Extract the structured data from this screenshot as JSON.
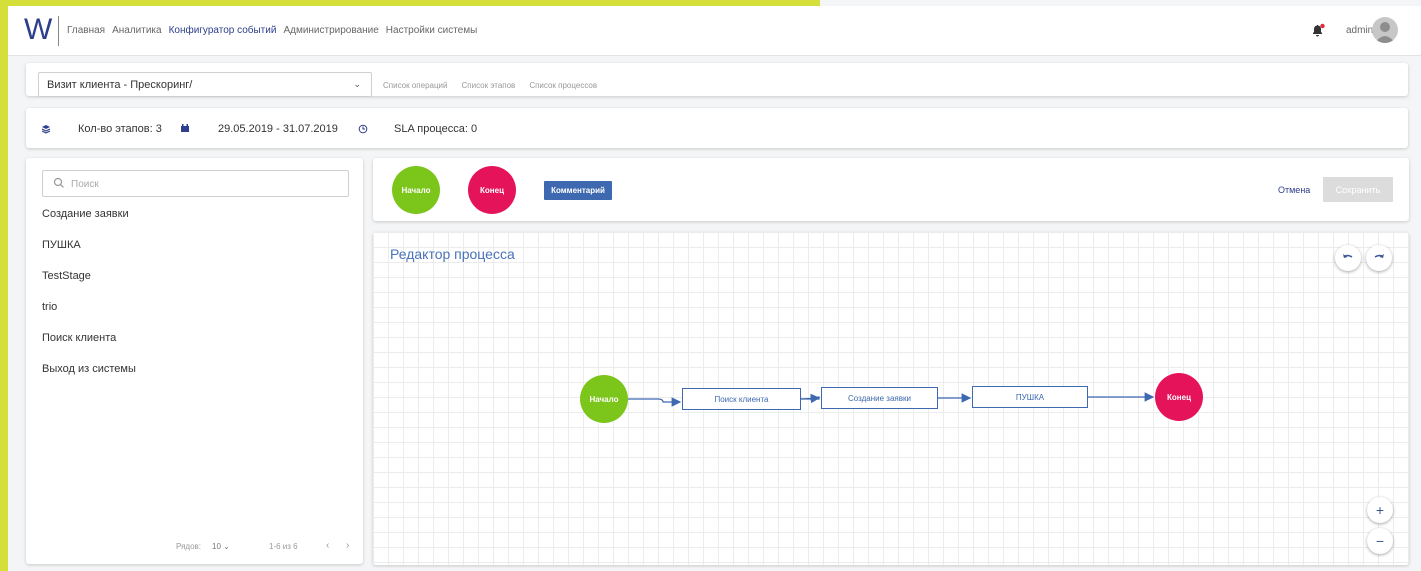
{
  "navbar": {
    "logo": "W",
    "items": [
      {
        "label": "Главная",
        "active": false
      },
      {
        "label": "Аналитика",
        "active": false
      },
      {
        "label": "Конфигуратор событий",
        "active": true
      },
      {
        "label": "Администрирование",
        "active": false
      },
      {
        "label": "Настройки системы",
        "active": false
      }
    ],
    "user": "admin",
    "notification_color": "#e5293f"
  },
  "toolbar": {
    "process_select": "Визит клиента - Прескоринг/",
    "links": [
      "Список операций",
      "Список этапов",
      "Список процессов"
    ]
  },
  "info": {
    "stages_count": "Кол-во этапов: 3",
    "date_range": "29.05.2019 - 31.07.2019",
    "sla": "SLA процесса: 0"
  },
  "stages_panel": {
    "search_placeholder": "Поиск",
    "items": [
      "Создание заявки",
      "ПУШКА",
      "TestStage",
      "trio",
      "Поиск клиента",
      "Выход из системы"
    ],
    "rows_label": "Рядов:",
    "rows_value": "10",
    "range": "1-6 из 6"
  },
  "palette": {
    "start": "Начало",
    "end": "Конец",
    "comment": "Комментарий",
    "cancel": "Отмена",
    "save": "Сохранить"
  },
  "editor": {
    "title": "Редактор процесса",
    "nodes": {
      "start": "Начало",
      "step1": "Поиск клиента",
      "step2": "Создание заявки",
      "step3": "ПУШКА",
      "end": "Конец"
    }
  },
  "colors": {
    "start": "#7cc51b",
    "end": "#e5145a",
    "accent": "#3e69b0",
    "brand": "#2c3e8c"
  }
}
